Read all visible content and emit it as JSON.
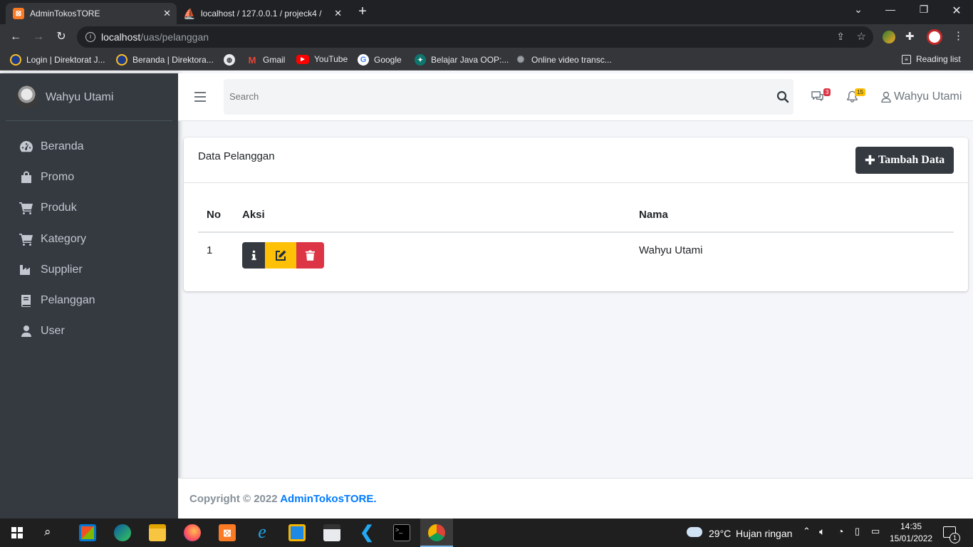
{
  "browser": {
    "tabs": [
      {
        "title": "AdminTokosTORE",
        "active": true
      },
      {
        "title": "localhost / 127.0.0.1 / projeck4 /",
        "active": false
      }
    ],
    "url_host": "localhost",
    "url_path": "/uas/pelanggan",
    "bookmarks": [
      "Login | Direktorat J...",
      "Beranda | Direktora...",
      "Gmail",
      "YouTube",
      "Google",
      "Belajar Java OOP:...",
      "Online video transc..."
    ],
    "reading_list": "Reading list"
  },
  "sidebar": {
    "username": "Wahyu Utami",
    "items": [
      {
        "label": "Beranda",
        "icon": "tachometer-icon"
      },
      {
        "label": "Promo",
        "icon": "shopping-bag-icon"
      },
      {
        "label": "Produk",
        "icon": "cart-icon"
      },
      {
        "label": "Kategory",
        "icon": "cart-icon"
      },
      {
        "label": "Supplier",
        "icon": "industry-icon"
      },
      {
        "label": "Pelanggan",
        "icon": "book-icon"
      },
      {
        "label": "User",
        "icon": "user-icon"
      }
    ]
  },
  "topnav": {
    "search_placeholder": "Search",
    "messages_count": "3",
    "notifications_count": "15",
    "user": "Wahyu Utami"
  },
  "card": {
    "title": "Data Pelanggan",
    "add_button": "Tambah Data",
    "columns": [
      "No",
      "Aksi",
      "Nama"
    ],
    "rows": [
      {
        "no": "1",
        "nama": "Wahyu Utami"
      }
    ]
  },
  "footer": {
    "prefix": "Copyright © 2022 ",
    "brand": "AdminTokosTORE."
  },
  "taskbar": {
    "weather": "29°C",
    "weather_desc": "Hujan ringan",
    "time": "14:35",
    "date": "15/01/2022",
    "notif_count": "1"
  },
  "colors": {
    "sidebar_bg": "#343a40",
    "primary": "#007bff",
    "warning": "#ffc107",
    "danger": "#dc3545",
    "dark": "#343a40"
  }
}
